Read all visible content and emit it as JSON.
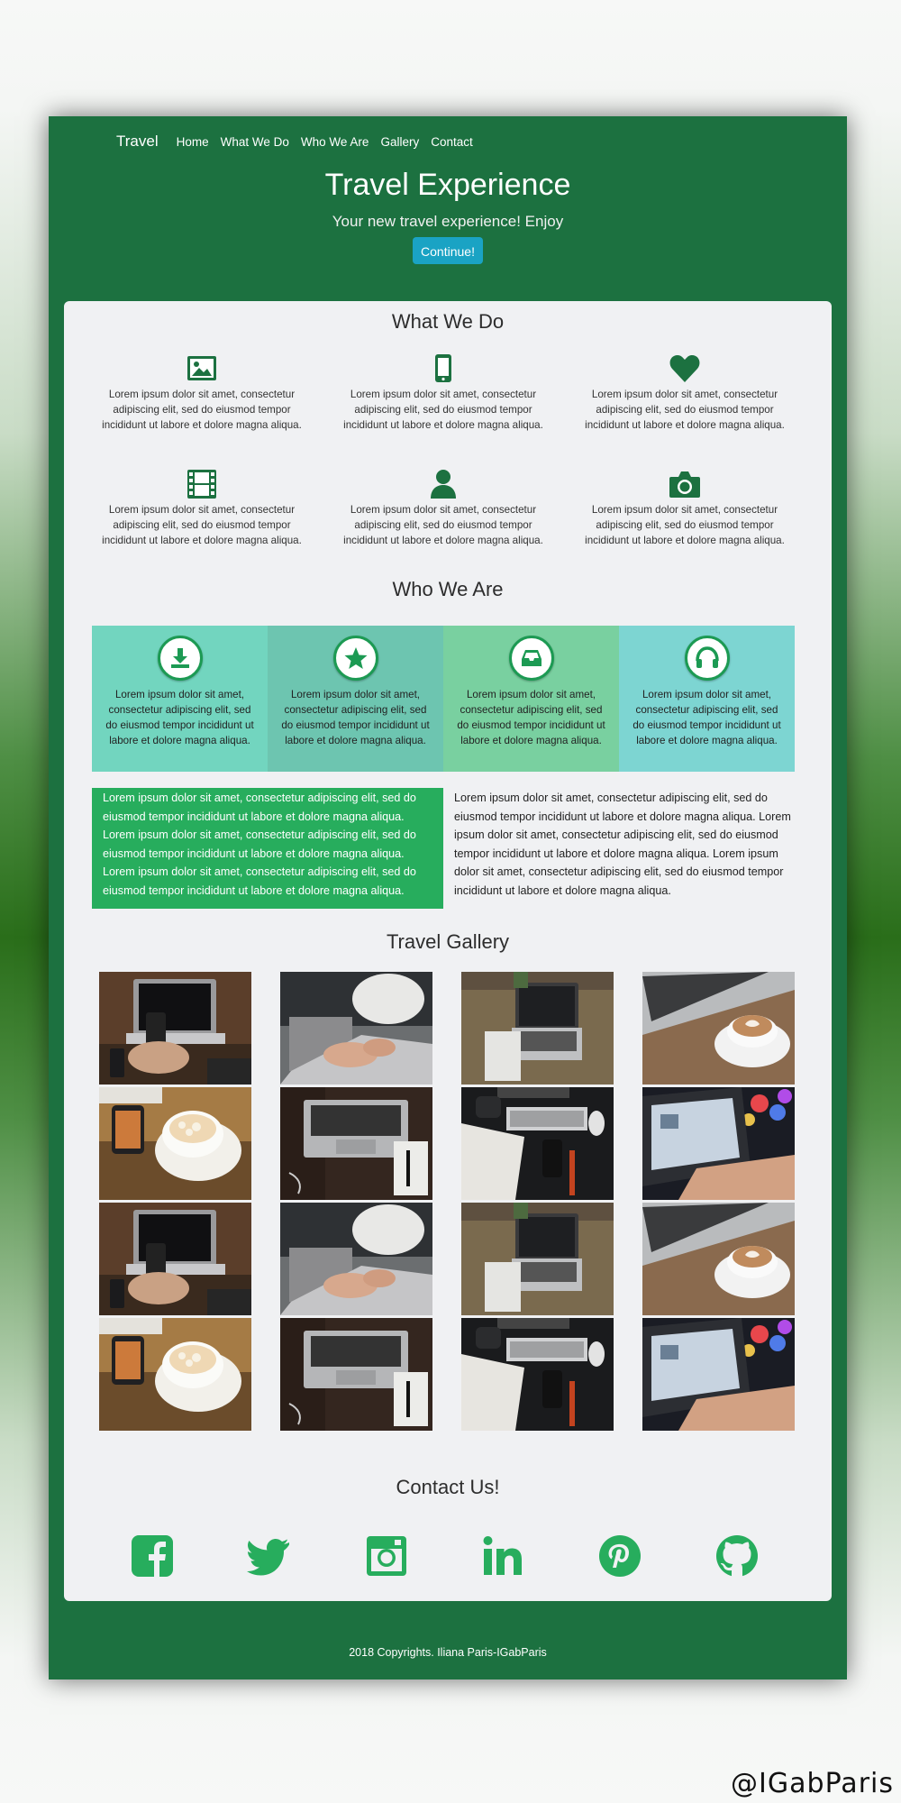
{
  "nav": {
    "brand": "Travel",
    "links": [
      "Home",
      "What We Do",
      "Who We Are",
      "Gallery",
      "Contact"
    ]
  },
  "hero": {
    "title": "Travel Experience",
    "subtitle": "Your new travel experience! Enjoy",
    "button": "Continue!"
  },
  "what_we_do": {
    "title": "What We Do",
    "items": [
      {
        "icon": "image-icon",
        "text": "Lorem ipsum dolor sit amet, consectetur adipiscing elit, sed do eiusmod tempor incididunt ut labore et dolore magna aliqua."
      },
      {
        "icon": "tablet-icon",
        "text": "Lorem ipsum dolor sit amet, consectetur adipiscing elit, sed do eiusmod tempor incididunt ut labore et dolore magna aliqua."
      },
      {
        "icon": "heart-icon",
        "text": "Lorem ipsum dolor sit amet, consectetur adipiscing elit, sed do eiusmod tempor incididunt ut labore et dolore magna aliqua."
      },
      {
        "icon": "film-icon",
        "text": "Lorem ipsum dolor sit amet, consectetur adipiscing elit, sed do eiusmod tempor incididunt ut labore et dolore magna aliqua."
      },
      {
        "icon": "user-icon",
        "text": "Lorem ipsum dolor sit amet, consectetur adipiscing elit, sed do eiusmod tempor incididunt ut labore et dolore magna aliqua."
      },
      {
        "icon": "camera-icon",
        "text": "Lorem ipsum dolor sit amet, consectetur adipiscing elit, sed do eiusmod tempor incididunt ut labore et dolore magna aliqua."
      }
    ]
  },
  "who_we_are": {
    "title": "Who We Are",
    "items": [
      {
        "icon": "download-icon",
        "color": "#72d5bf",
        "text": "Lorem ipsum dolor sit amet, consectetur adipiscing elit, sed do eiusmod tempor incididunt ut labore et dolore magna aliqua."
      },
      {
        "icon": "star-icon",
        "color": "#6dc5b0",
        "text": "Lorem ipsum dolor sit amet, consectetur adipiscing elit, sed do eiusmod tempor incididunt ut labore et dolore magna aliqua."
      },
      {
        "icon": "inbox-icon",
        "color": "#79d0a0",
        "text": "Lorem ipsum dolor sit amet, consectetur adipiscing elit, sed do eiusmod tempor incididunt ut labore et dolore magna aliqua."
      },
      {
        "icon": "headphones-icon",
        "color": "#7dd5d2",
        "text": "Lorem ipsum dolor sit amet, consectetur adipiscing elit, sed do eiusmod tempor incididunt ut labore et dolore magna aliqua."
      }
    ],
    "green_box_text": "Lorem ipsum dolor sit amet, consectetur adipiscing elit, sed do eiusmod tempor incididunt ut labore et dolore magna aliqua. Lorem ipsum dolor sit amet, consectetur adipiscing elit, sed do eiusmod tempor incididunt ut labore et dolore magna aliqua. Lorem ipsum dolor sit amet, consectetur adipiscing elit, sed do eiusmod tempor incididunt ut labore et dolore magna aliqua.",
    "plain_box_text": "Lorem ipsum dolor sit amet, consectetur adipiscing elit, sed do eiusmod tempor incididunt ut labore et dolore magna aliqua. Lorem ipsum dolor sit amet, consectetur adipiscing elit, sed do eiusmod tempor incididunt ut labore et dolore magna aliqua. Lorem ipsum dolor sit amet, consectetur adipiscing elit, sed do eiusmod tempor incididunt ut labore et dolore magna aliqua."
  },
  "gallery": {
    "title": "Travel Gallery",
    "photos": [
      "laptop-phone",
      "typing-laptop",
      "desk-laptop",
      "coffee-laptop",
      "coffee-phone",
      "laptop-topview",
      "keyboard-desk",
      "laptop-hand",
      "laptop-phone",
      "typing-laptop",
      "desk-laptop",
      "coffee-laptop",
      "coffee-phone",
      "laptop-topview",
      "keyboard-desk",
      "laptop-hand"
    ]
  },
  "contact": {
    "title": "Contact Us!",
    "icons": [
      "facebook-icon",
      "twitter-icon",
      "instagram-icon",
      "linkedin-icon",
      "pinterest-icon",
      "github-icon"
    ],
    "icon_color": "#27ad5d"
  },
  "footer": {
    "text": "2018 Copyrights. Iliana Paris-IGabParis"
  },
  "watermark": "@IGabParis",
  "colors": {
    "frame": "#1c7140",
    "icon_dark": "#1c7140",
    "accent": "#27ad5d",
    "button": "#1aa3c4"
  }
}
